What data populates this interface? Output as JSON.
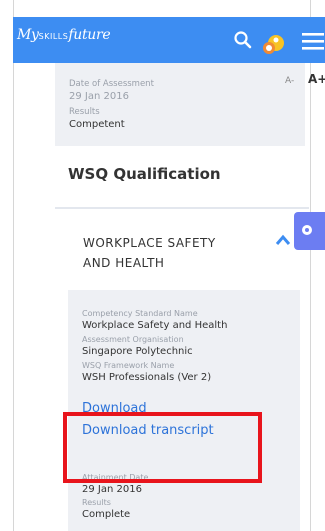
{
  "header": {
    "logo_prefix": "My",
    "logo_caps": "SKILLS",
    "logo_suffix": "future",
    "brand_color": "#3d8df2",
    "icons": [
      "search-icon",
      "avatar",
      "hamburger-menu-icon"
    ]
  },
  "font_controls": {
    "decrease": "A-",
    "increase": "A+"
  },
  "assessment": {
    "date_label": "Date of Assessment",
    "date_value": "29 Jan 2016",
    "results_label": "Results",
    "results_value": "Competent"
  },
  "qualification": {
    "section_title": "WSQ Qualification",
    "item_title": "WORKPLACE SAFETY AND HEALTH",
    "fields": [
      {
        "label": "Competency Standard Name",
        "value": "Workplace Safety and Health"
      },
      {
        "label": "Assessment Organisation",
        "value": "Singapore Polytechnic"
      },
      {
        "label": "WSQ Framework Name",
        "value": "WSH Professionals (Ver 2)"
      }
    ],
    "download_label": "Download",
    "download_transcript_label": "Download transcript",
    "attainment_label": "Attainment Date",
    "attainment_value": "29 Jan 2016",
    "results_label": "Results",
    "results_value": "Complete"
  }
}
